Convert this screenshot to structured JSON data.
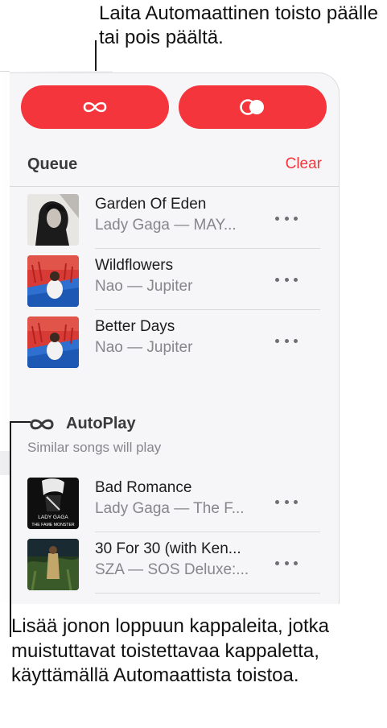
{
  "callouts": {
    "top": "Laita Automaattinen toisto päälle tai pois päältä.",
    "bottom": "Lisää jonon loppuun kappaleita, jotka muistuttavat toistettavaa kappaletta, käyttämällä Automaattista toistoa."
  },
  "panel": {
    "accent_color": "#f5353c",
    "autoplay_button_icon": "infinity-icon",
    "shuffle_button_icon": "shuffle-icon"
  },
  "queue": {
    "title": "Queue",
    "clear_label": "Clear",
    "tracks": [
      {
        "title": "Garden Of Eden",
        "subtitle": "Lady Gaga — MAY...",
        "art": "garden-of-eden-artwork"
      },
      {
        "title": "Wildflowers",
        "subtitle": "Nao — Jupiter",
        "art": "jupiter-artwork"
      },
      {
        "title": "Better Days",
        "subtitle": "Nao — Jupiter",
        "art": "jupiter-artwork"
      }
    ]
  },
  "autoplay": {
    "title": "AutoPlay",
    "subtitle": "Similar songs will play",
    "tracks": [
      {
        "title": "Bad Romance",
        "subtitle": "Lady Gaga — The F...",
        "art": "the-fame-monster-artwork",
        "art_text_1": "LADY GAGA",
        "art_text_2": "THE FAME MONSTER"
      },
      {
        "title": "30 For 30 (with Ken...",
        "subtitle": "SZA — SOS Deluxe:...",
        "art": "sos-deluxe-artwork"
      }
    ]
  }
}
